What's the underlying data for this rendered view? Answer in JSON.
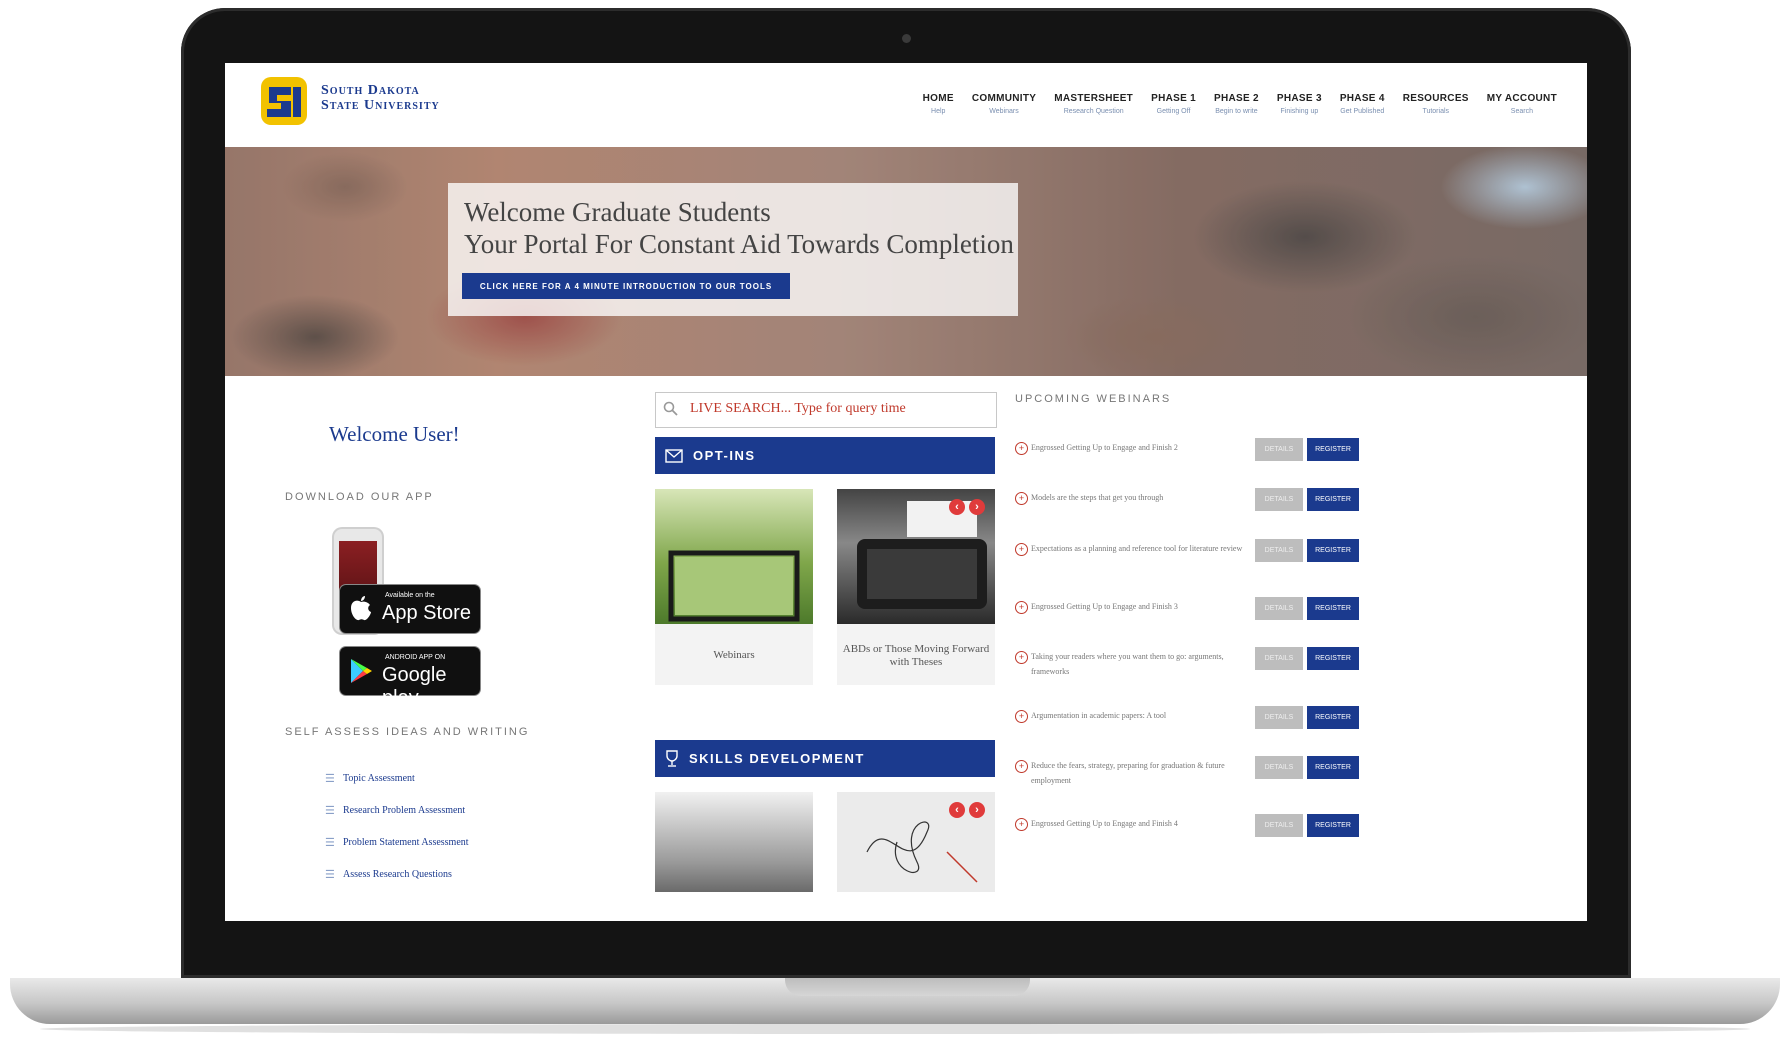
{
  "brand": {
    "line1": "South Dakota",
    "line2": "State University",
    "colors": {
      "primary": "#1b3a8e",
      "accent": "#c0392b",
      "gold": "#f2c200"
    }
  },
  "nav": [
    {
      "label": "HOME",
      "sub": "Help"
    },
    {
      "label": "COMMUNITY",
      "sub": "Webinars"
    },
    {
      "label": "MASTERSHEET",
      "sub": "Research Question"
    },
    {
      "label": "PHASE 1",
      "sub": "Getting Off"
    },
    {
      "label": "PHASE 2",
      "sub": "Begin to write"
    },
    {
      "label": "PHASE 3",
      "sub": "Finishing up"
    },
    {
      "label": "PHASE 4",
      "sub": "Get Published"
    },
    {
      "label": "RESOURCES",
      "sub": "Tutorials"
    },
    {
      "label": "MY ACCOUNT",
      "sub": "Search"
    }
  ],
  "hero": {
    "line1": "Welcome Graduate Students",
    "line2": "Your Portal For Constant Aid Towards Completion",
    "button": "CLICK HERE FOR A 4 MINUTE INTRODUCTION TO OUR TOOLS"
  },
  "left": {
    "welcome": "Welcome User!",
    "download_title": "DOWNLOAD OUR APP",
    "app_store_small": "Available on the",
    "app_store_big": "App Store",
    "google_small": "ANDROID APP ON",
    "google_big": "Google play",
    "assess_title": "SELF ASSESS IDEAS AND WRITING",
    "assess_items": [
      "Topic Assessment",
      "Research Problem Assessment",
      "Problem Statement Assessment",
      "Assess Research Questions"
    ]
  },
  "middle": {
    "search_placeholder": "LIVE SEARCH... Type for query time",
    "optins_label": "OPT-INS",
    "card1_caption": "Webinars",
    "card2_caption": "ABDs or Those Moving Forward with Theses",
    "skills_label": "SKILLS DEVELOPMENT"
  },
  "right": {
    "heading": "UPCOMING WEBINARS",
    "details_label": "DETAILS",
    "register_label": "REGISTER",
    "webinars": [
      "Engrossed Getting Up to Engage and Finish 2",
      "Models are the steps that get you through",
      "Expectations as a planning and reference tool for literature review",
      "Engrossed Getting Up to Engage and Finish 3",
      "Taking your readers where you want them to go: arguments, frameworks",
      "Argumentation in academic papers: A tool",
      "Reduce the fears, strategy, preparing for graduation & future employment",
      "Engrossed Getting Up to Engage and Finish 4"
    ]
  }
}
